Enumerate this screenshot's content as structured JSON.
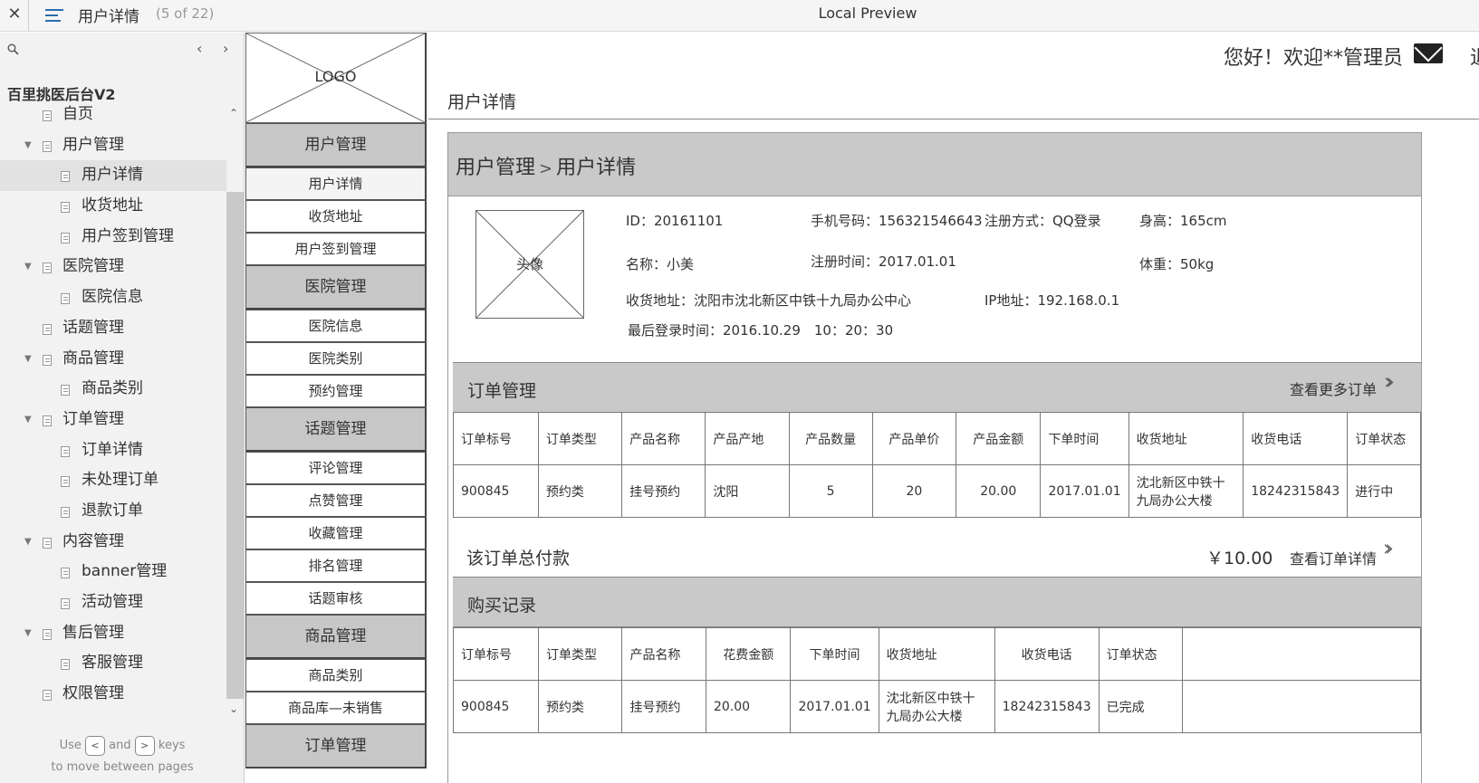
{
  "topbar": {
    "close": "✕",
    "page_title": "用户详情",
    "page_count": "(5 of 22)",
    "preview_title": "Local Preview"
  },
  "sitemap": {
    "search_icon": "search-icon",
    "prev": "‹",
    "next": "›",
    "project": "百里挑医后台V2",
    "items": [
      {
        "label": "自页",
        "level": 1,
        "folder": false
      },
      {
        "label": "用户管理",
        "level": 1,
        "folder": true
      },
      {
        "label": "用户详情",
        "level": 2,
        "folder": false,
        "active": true
      },
      {
        "label": "收货地址",
        "level": 2,
        "folder": false
      },
      {
        "label": "用户签到管理",
        "level": 2,
        "folder": false
      },
      {
        "label": "医院管理",
        "level": 1,
        "folder": true
      },
      {
        "label": "医院信息",
        "level": 2,
        "folder": false
      },
      {
        "label": "话题管理",
        "level": 1,
        "folder": false
      },
      {
        "label": "商品管理",
        "level": 1,
        "folder": true
      },
      {
        "label": "商品类别",
        "level": 2,
        "folder": false
      },
      {
        "label": "订单管理",
        "level": 1,
        "folder": true
      },
      {
        "label": "订单详情",
        "level": 2,
        "folder": false
      },
      {
        "label": "未处理订单",
        "level": 2,
        "folder": false
      },
      {
        "label": "退款订单",
        "level": 2,
        "folder": false
      },
      {
        "label": "内容管理",
        "level": 1,
        "folder": true
      },
      {
        "label": "banner管理",
        "level": 2,
        "folder": false
      },
      {
        "label": "活动管理",
        "level": 2,
        "folder": false
      },
      {
        "label": "售后管理",
        "level": 1,
        "folder": true
      },
      {
        "label": "客服管理",
        "level": 2,
        "folder": false
      },
      {
        "label": "权限管理",
        "level": 1,
        "folder": false
      }
    ],
    "hint_use": "Use",
    "hint_and": "and",
    "hint_keys": "keys",
    "hint_line2": "to move between pages",
    "key_prev": "<",
    "key_next": ">"
  },
  "nav": {
    "logo": "LOGO",
    "items": [
      {
        "label": "用户管理",
        "group": true
      },
      {
        "label": "用户详情",
        "group": false,
        "current": true
      },
      {
        "label": "收货地址",
        "group": false
      },
      {
        "label": "用户签到管理",
        "group": false
      },
      {
        "label": "医院管理",
        "group": true
      },
      {
        "label": "医院信息",
        "group": false
      },
      {
        "label": "医院类别",
        "group": false
      },
      {
        "label": "预约管理",
        "group": false
      },
      {
        "label": "话题管理",
        "group": true
      },
      {
        "label": "评论管理",
        "group": false
      },
      {
        "label": "点赞管理",
        "group": false
      },
      {
        "label": "收藏管理",
        "group": false
      },
      {
        "label": "排名管理",
        "group": false
      },
      {
        "label": "话题审核",
        "group": false
      },
      {
        "label": "商品管理",
        "group": true
      },
      {
        "label": "商品类别",
        "group": false
      },
      {
        "label": "商品库—未销售",
        "group": false
      },
      {
        "label": "订单管理",
        "group": true
      }
    ]
  },
  "header": {
    "greeting": "您好！欢迎**管理员",
    "exit": "退",
    "page_heading": "用户详情"
  },
  "detail": {
    "breadcrumb_parent": "用户管理",
    "breadcrumb_sep": ">",
    "breadcrumb_current": "用户详情",
    "avatar": "头像",
    "id": "ID：20161101",
    "phone": "手机号码：156321546643",
    "register_method": "注册方式：QQ登录",
    "height": "身高：165cm",
    "name": "名称：小美",
    "register_time": "注册时间：2017.01.01",
    "weight": "体重：50kg",
    "address": "收货地址：沈阳市沈北新区中铁十九局办公中心",
    "ip": "IP地址：192.168.0.1",
    "last_login": "最后登录时间：2016.10.29　10：20：30"
  },
  "orders": {
    "title": "订单管理",
    "more": "查看更多订单",
    "headers": [
      "订单标号",
      "订单类型",
      "产品名称",
      "产品产地",
      "产品数量",
      "产品单价",
      "产品金额",
      "下单时间",
      "收货地址",
      "收货电话",
      "订单状态"
    ],
    "rows": [
      [
        "900845",
        "预约类",
        "挂号预约",
        "沈阳",
        "5",
        "20",
        "20.00",
        "2017.01.01",
        "沈北新区中铁十九局办公大楼",
        "18242315843",
        "进行中"
      ]
    ],
    "total_label": "该订单总付款",
    "total_amount": "￥10.00",
    "detail_link": "查看订单详情"
  },
  "purchases": {
    "title": "购买记录",
    "headers": [
      "订单标号",
      "订单类型",
      "产品名称",
      "花费金额",
      "下单时间",
      "收货地址",
      "收货电话",
      "订单状态",
      ""
    ],
    "rows": [
      [
        "900845",
        "预约类",
        "挂号预约",
        "20.00",
        "2017.01.01",
        "沈北新区中铁十九局办公大楼",
        "18242315843",
        "已完成",
        ""
      ]
    ]
  }
}
